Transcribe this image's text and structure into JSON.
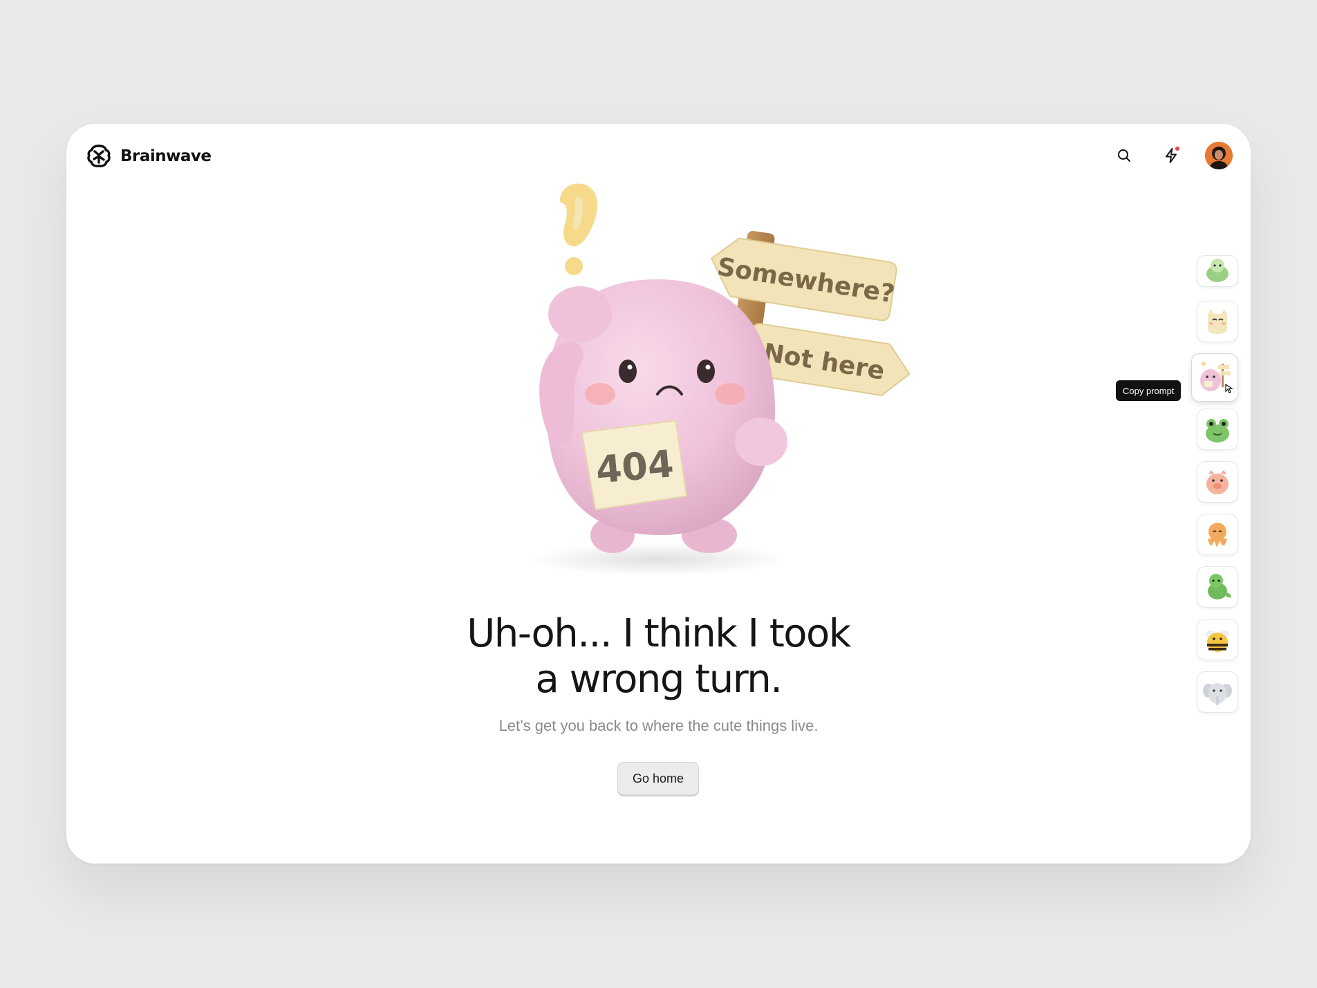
{
  "header": {
    "brand": "Brainwave",
    "icons": [
      "brain-logo-icon",
      "search-icon",
      "lightning-icon",
      "user-avatar"
    ],
    "notification_dot_color": "#ef4444"
  },
  "illustration": {
    "sign_top": "Somewhere?",
    "sign_bottom": "Not here",
    "badge": "404"
  },
  "main": {
    "headline_line1": "Uh-oh... I think I took",
    "headline_line2": "a wrong turn.",
    "subtitle": "Let’s get you back to where the cute things live.",
    "cta_label": "Go home"
  },
  "sidebar": {
    "tooltip": "Copy prompt",
    "thumbnails": [
      "turtle",
      "cat",
      "pink-404-creature",
      "frog",
      "pig",
      "octopus",
      "dinosaur",
      "bee",
      "elephant"
    ],
    "active_thumbnail": "pink-404-creature"
  },
  "colors": {
    "card": "#ffffff",
    "background": "#e9e9ea",
    "creature_pink": "#efc4dc",
    "sign_wood": "#f2e3b8",
    "post_brown": "#b98a55",
    "question_yellow": "#f7d98a"
  }
}
